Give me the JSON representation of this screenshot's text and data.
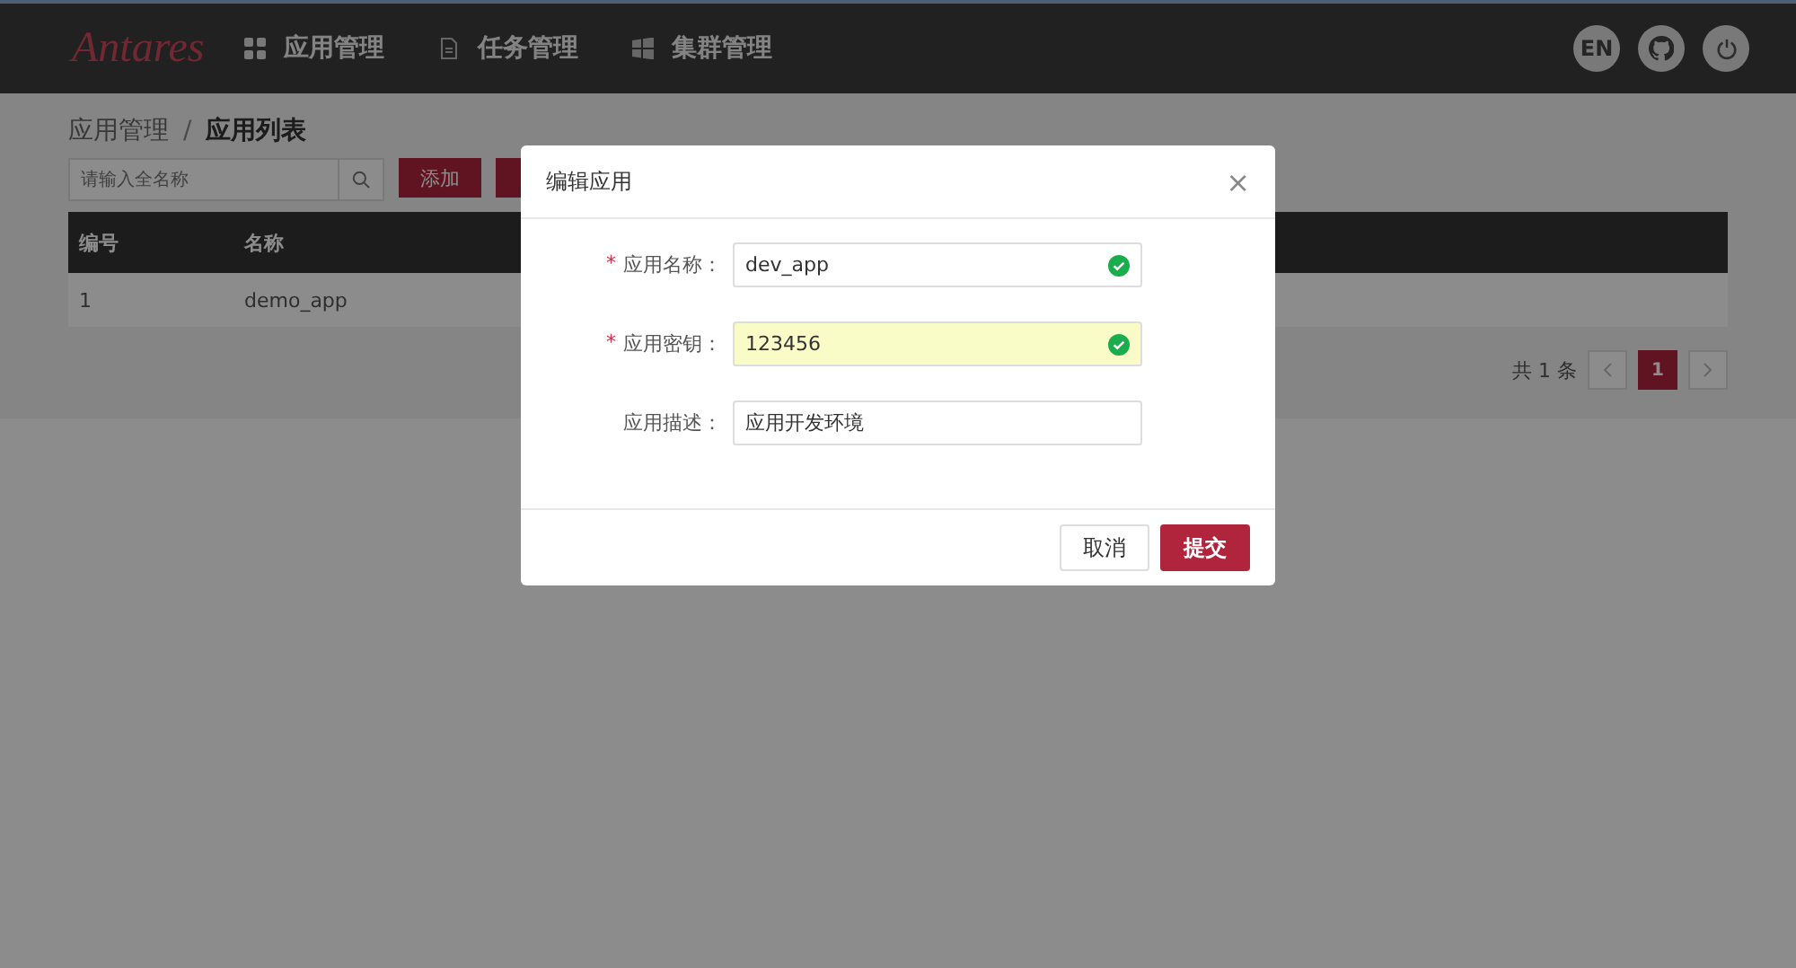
{
  "header": {
    "logo": "Antares",
    "nav": [
      {
        "label": "应用管理"
      },
      {
        "label": "任务管理"
      },
      {
        "label": "集群管理"
      }
    ],
    "actions": [
      {
        "kind": "text",
        "label": "EN"
      },
      {
        "kind": "github"
      },
      {
        "kind": "power"
      }
    ]
  },
  "breadcrumb": {
    "separator": "/",
    "items": [
      "应用管理",
      "应用列表"
    ]
  },
  "toolbar": {
    "search": {
      "placeholder": "请输入全名称"
    },
    "buttons": [
      {
        "kind": "add",
        "label": "添加"
      },
      {
        "kind": "partial"
      }
    ]
  },
  "table": {
    "columns": [
      "编号",
      "名称"
    ],
    "rows": [
      [
        "1",
        "demo_app"
      ]
    ]
  },
  "pagination": {
    "total": "共 1 条",
    "pages": [
      {
        "label": "1",
        "selected": true
      }
    ]
  },
  "dialog": {
    "title": "编辑应用",
    "close": "×",
    "required_mark": "*",
    "fields": [
      {
        "label": "应用名称：",
        "required": true,
        "value": "dev_app",
        "valid": true,
        "autofilled": false
      },
      {
        "label": "应用密钥：",
        "required": true,
        "value": "123456",
        "valid": true,
        "autofilled": true
      },
      {
        "label": "应用描述：",
        "required": false,
        "value": "应用开发环境",
        "valid": false,
        "autofilled": false
      }
    ],
    "buttons": [
      {
        "label": "取消",
        "primary": false
      },
      {
        "label": "提交",
        "primary": true
      }
    ]
  }
}
